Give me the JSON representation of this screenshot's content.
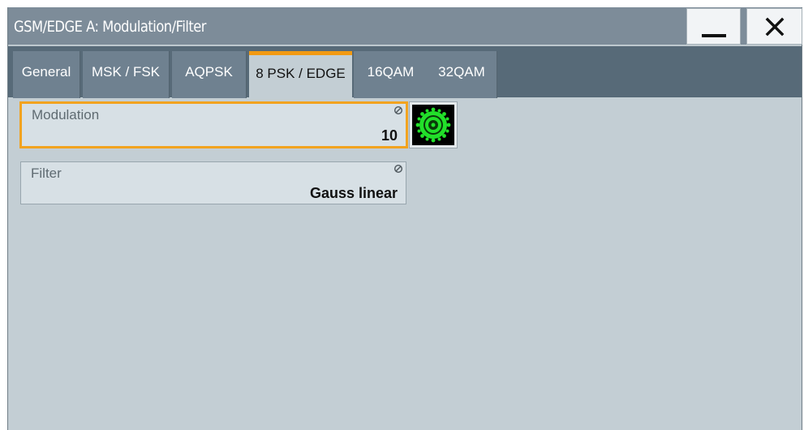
{
  "window": {
    "title": "GSM/EDGE A: Modulation/Filter",
    "minimize_glyph": "minimize-icon",
    "close_glyph": "✕"
  },
  "tabs": [
    {
      "label": "General",
      "active": false
    },
    {
      "label": "MSK / FSK",
      "active": false
    },
    {
      "label": "AQPSK",
      "active": false
    },
    {
      "label": "8 PSK / EDGE",
      "active": true
    },
    {
      "label": "16QAM",
      "active": false
    },
    {
      "label": "32QAM",
      "active": false
    }
  ],
  "modulation": {
    "label": "Modulation",
    "value": "10",
    "focused": true,
    "icon": "constellation-icon"
  },
  "filter": {
    "label": "Filter",
    "value": "Gauss linear"
  },
  "colors": {
    "accent": "#f29a12",
    "title_bar": "#7d8c99",
    "tab_bar": "#576a78",
    "background": "#c3ced4",
    "constellation": "#22e02a"
  }
}
